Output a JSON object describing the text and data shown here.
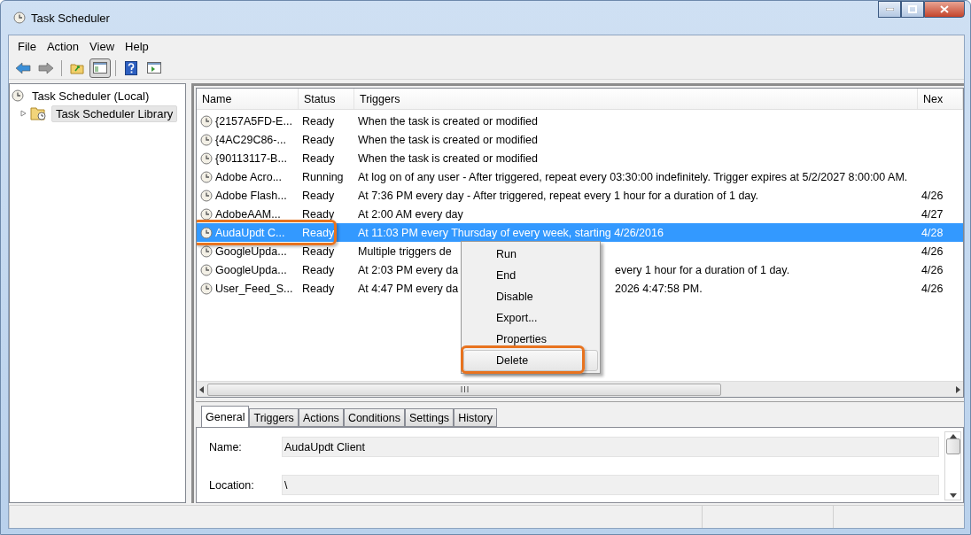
{
  "window": {
    "title": "Task Scheduler"
  },
  "menu_bar": [
    "File",
    "Action",
    "View",
    "Help"
  ],
  "toolbar": [
    {
      "kind": "back",
      "pressed": false
    },
    {
      "kind": "forward",
      "pressed": false
    },
    {
      "kind": "sep"
    },
    {
      "kind": "up",
      "pressed": false
    },
    {
      "kind": "tree",
      "pressed": true
    },
    {
      "kind": "sep"
    },
    {
      "kind": "help",
      "pressed": false
    },
    {
      "kind": "pane",
      "pressed": false
    }
  ],
  "tree": [
    {
      "label": "Task Scheduler (Local)",
      "selected": false,
      "children": [
        {
          "label": "Task Scheduler Library",
          "selected": true,
          "expanded": false
        }
      ]
    }
  ],
  "table": {
    "columns": [
      "Name",
      "Status",
      "Triggers",
      "Nex"
    ],
    "rows": [
      {
        "name": "{2157A5FD-E...",
        "status": "Ready",
        "trigger": "When the task is created or modified",
        "selected": false
      },
      {
        "name": "{4AC29C86-...",
        "status": "Ready",
        "trigger": "When the task is created or modified",
        "selected": false
      },
      {
        "name": "{90113117-B...",
        "status": "Ready",
        "trigger": "When the task is created or modified",
        "selected": false
      },
      {
        "name": "Adobe Acro...",
        "status": "Running",
        "trigger": "At log on of any user - After triggered, repeat every 03:30:00 indefinitely. Trigger expires at 5/2/2027 8:00:00 AM.",
        "selected": false
      },
      {
        "name": "Adobe Flash...",
        "status": "Ready",
        "trigger": "At 7:36 PM every day - After triggered, repeat every 1 hour for a duration of 1 day.",
        "next": "4/26",
        "selected": false
      },
      {
        "name": "AdobeAAM...",
        "status": "Ready",
        "trigger": "At 2:00 AM every day",
        "next": "4/27",
        "selected": false
      },
      {
        "name": "AudaUpdt C...",
        "status": "Ready",
        "trigger": "At 11:03 PM every Thursday of every week, starting 4/26/2016",
        "next": "4/28",
        "selected": true
      },
      {
        "name": "GoogleUpda...",
        "status": "Ready",
        "trigger": "Multiple triggers de",
        "next": "4/26",
        "selected": false
      },
      {
        "name": "GoogleUpda...",
        "status": "Ready",
        "trigger": "At 2:03 PM every da",
        "trigger_tail": "every 1 hour for a duration of 1 day.",
        "next": "4/26",
        "selected": false
      },
      {
        "name": "User_Feed_S...",
        "status": "Ready",
        "trigger": "At 4:47 PM every da",
        "trigger_tail": "2026 4:47:58 PM.",
        "next": "4/26",
        "selected": false
      }
    ]
  },
  "context_menu": {
    "items": [
      {
        "label": "Run",
        "highlighted": false
      },
      {
        "label": "End",
        "highlighted": false
      },
      {
        "label": "Disable",
        "highlighted": false
      },
      {
        "label": "Export...",
        "highlighted": false
      },
      {
        "label": "Properties",
        "highlighted": false
      },
      {
        "label": "Delete",
        "highlighted": true
      }
    ]
  },
  "details": {
    "tabs": [
      {
        "label": "General",
        "selected": true
      },
      {
        "label": "Triggers",
        "selected": false
      },
      {
        "label": "Actions",
        "selected": false
      },
      {
        "label": "Conditions",
        "selected": false
      },
      {
        "label": "Settings",
        "selected": false
      },
      {
        "label": "History",
        "selected": false
      }
    ],
    "fields": [
      {
        "label": "Name:",
        "value": "AudaUpdt Client"
      },
      {
        "label": "Location:",
        "value": "\\"
      }
    ]
  }
}
